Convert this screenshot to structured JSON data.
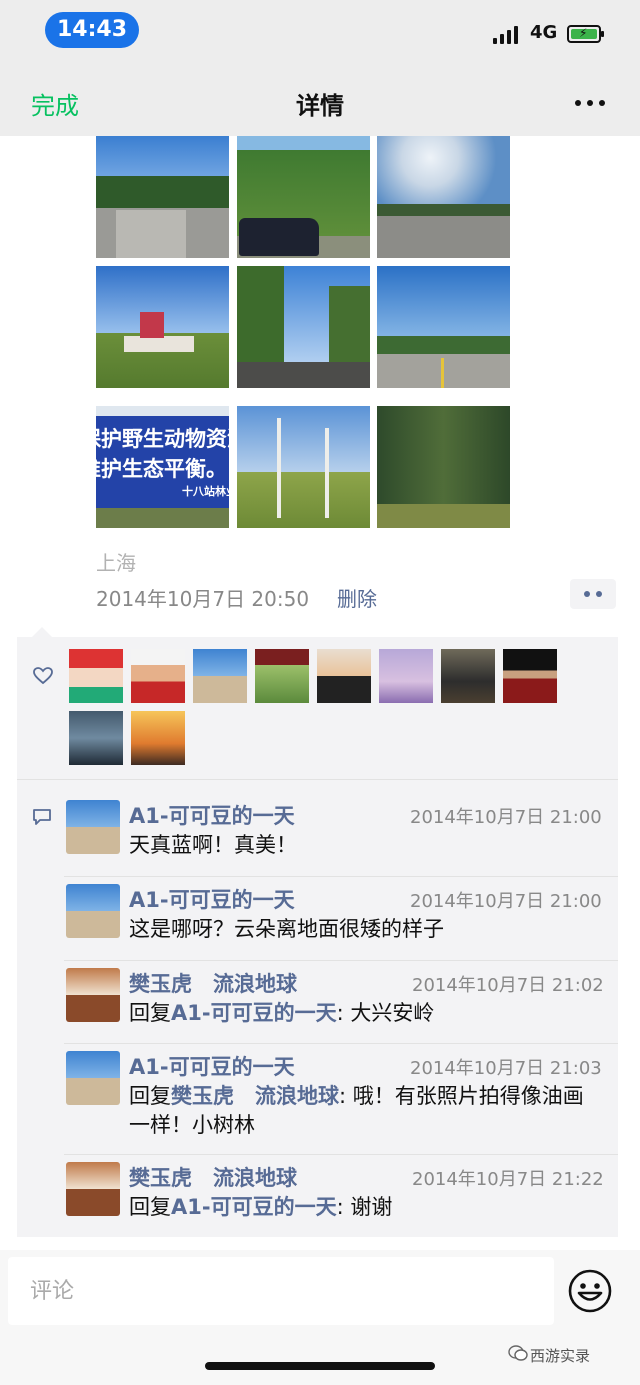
{
  "status_bar": {
    "time": "14:43",
    "network": "4G"
  },
  "navbar": {
    "done_label": "完成",
    "title": "详情"
  },
  "post": {
    "sign_text_line1": "保护野生动物资源",
    "sign_text_line2": "维护生态平衡。",
    "sign_text_small": "十八站林业",
    "location": "上海",
    "timestamp": "2014年10月7日 20:50",
    "delete_label": "删除"
  },
  "comments": [
    {
      "name": "A1-可可豆的一天",
      "time": "2014年10月7日 21:00",
      "text": "天真蓝啊！真美！"
    },
    {
      "name": "A1-可可豆的一天",
      "time": "2014年10月7日 21:00",
      "text": "这是哪呀？云朵离地面很矮的样子"
    },
    {
      "name": "樊玉虎　流浪地球",
      "time": "2014年10月7日 21:02",
      "reply_prefix": "回复",
      "reply_to": "A1-可可豆的一天",
      "text": ": 大兴安岭"
    },
    {
      "name": "A1-可可豆的一天",
      "time": "2014年10月7日 21:03",
      "reply_prefix": "回复",
      "reply_to": "樊玉虎　流浪地球",
      "text": ": 哦！有张照片拍得像油画一样！小树林"
    },
    {
      "name": "樊玉虎　流浪地球",
      "time": "2014年10月7日 21:22",
      "reply_prefix": "回复",
      "reply_to": "A1-可可豆的一天",
      "text": ": 谢谢"
    }
  ],
  "comment_input": {
    "placeholder": "评论"
  },
  "watermark": "西游实录"
}
